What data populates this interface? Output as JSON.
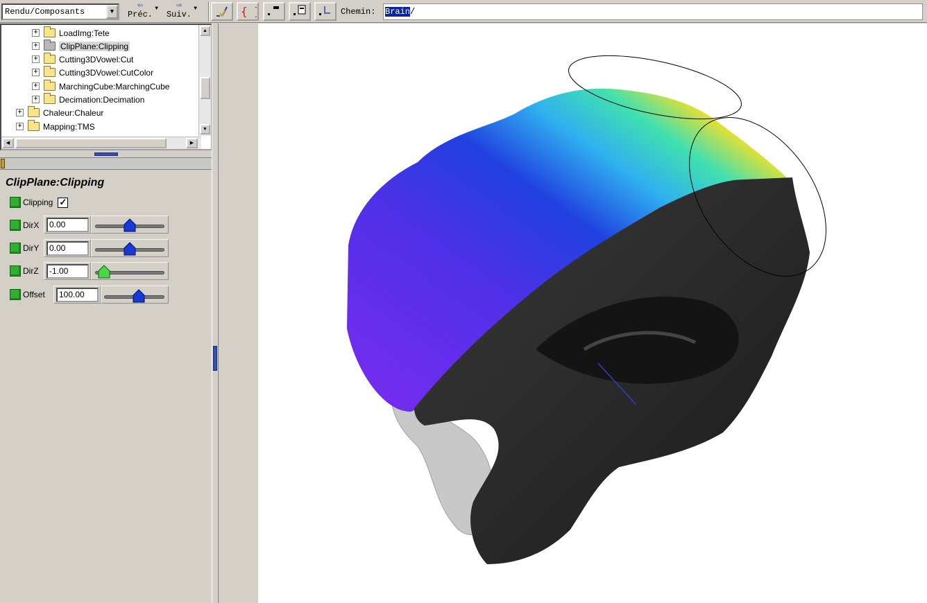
{
  "toolbar": {
    "combo_value": "Rendu/Composants",
    "prev_label": "Préc.",
    "next_label": "Suiv.",
    "path_label": "Chemin:",
    "path_selected": "Brain",
    "path_rest": "/"
  },
  "tree": {
    "items": [
      {
        "label": "LoadImg:Tete"
      },
      {
        "label": "ClipPlane:Clipping"
      },
      {
        "label": "Cutting3DVowel:Cut"
      },
      {
        "label": "Cutting3DVowel:CutColor"
      },
      {
        "label": "MarchingCube:MarchingCube"
      },
      {
        "label": "Decimation:Decimation"
      },
      {
        "label": "Chaleur:Chaleur"
      },
      {
        "label": "Mapping:TMS"
      }
    ]
  },
  "properties": {
    "title": "ClipPlane:Clipping",
    "clipping_label": "Clipping",
    "clipping_checked": true,
    "params": [
      {
        "label": "DirX",
        "value": "0.00",
        "slider": 0.5
      },
      {
        "label": "DirY",
        "value": "0.00",
        "slider": 0.5
      },
      {
        "label": "DirZ",
        "value": "-1.00",
        "slider": 0.0
      },
      {
        "label": "Offset",
        "value": "100.00",
        "slider": 0.58
      }
    ]
  },
  "colors": {
    "selection": "#0a24a8",
    "slider_thumb_active": "#1838d8",
    "slider_thumb_min": "#48d848",
    "property_icon": "#30b030"
  }
}
